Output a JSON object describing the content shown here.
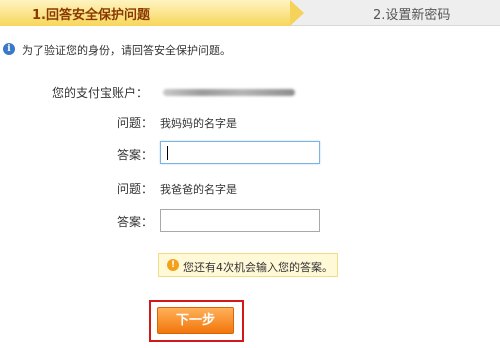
{
  "steps": {
    "current": "1.回答安全保护问题",
    "next": "2.设置新密码"
  },
  "info": {
    "icon": "info-icon",
    "text": "为了验证您的身份，请回答安全保护问题。"
  },
  "account": {
    "label": "您的支付宝账户："
  },
  "questions": [
    {
      "question_label": "问题：",
      "question": "我妈妈的名字是",
      "answer_label": "答案：",
      "answer_value": ""
    },
    {
      "question_label": "问题：",
      "question": "我爸爸的名字是",
      "answer_label": "答案：",
      "answer_value": ""
    }
  ],
  "notice": {
    "icon": "warning-icon",
    "text": "您还有4次机会输入您的答案。"
  },
  "actions": {
    "next_label": "下一步"
  },
  "colors": {
    "active_step": "#f7d65a",
    "button": "#f2760b",
    "highlight": "#d31818"
  }
}
